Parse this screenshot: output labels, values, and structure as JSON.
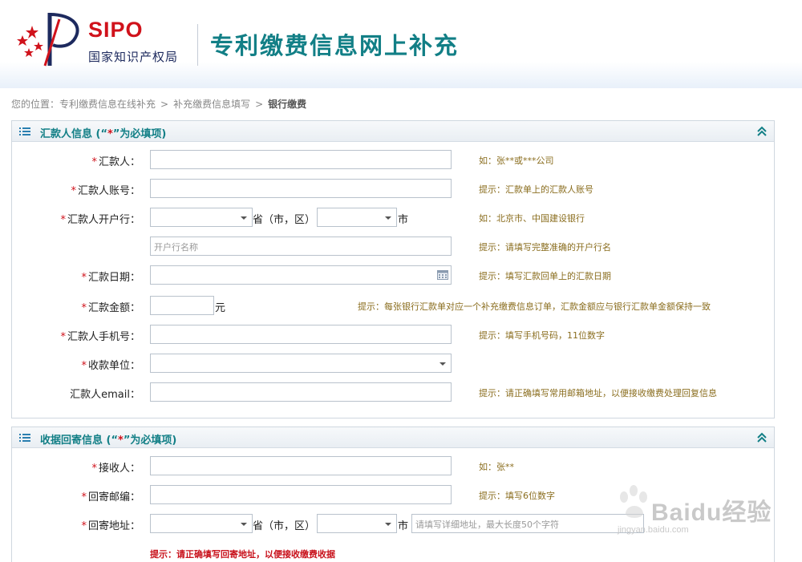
{
  "header": {
    "logo_text": "SIPO",
    "logo_subtitle": "国家知识产权局",
    "title": "专利缴费信息网上补充"
  },
  "breadcrumb": {
    "prefix": "您的位置：",
    "items": [
      "专利缴费信息在线补充",
      "补充缴费信息填写",
      "银行缴费"
    ],
    "separator": ">"
  },
  "remitter_panel": {
    "title_prefix": "汇款人信息 (“",
    "title_star": "*",
    "title_suffix": "”为必填项)",
    "fields": {
      "name": {
        "label": "汇款人：",
        "required": "*",
        "value": "",
        "hint": "如：张**或***公司"
      },
      "account": {
        "label": "汇款人账号：",
        "required": "*",
        "value": "",
        "hint": "提示：汇款单上的汇款人账号"
      },
      "bank": {
        "label": "汇款人开户行：",
        "required": "*",
        "province_value": "",
        "province_suffix": "省（市，区）",
        "city_value": "",
        "city_suffix": "市",
        "hint": "如：北京市、中国建设银行",
        "bank_name_placeholder": "开户行名称",
        "bank_name_hint": "提示：请填写完整准确的开户行名",
        "calendar_icon": "calendar-icon"
      },
      "date": {
        "label": "汇款日期：",
        "required": "*",
        "value": "",
        "hint": "提示：填写汇款回单上的汇款日期"
      },
      "amount": {
        "label": "汇款金额：",
        "required": "*",
        "value": "",
        "unit": "元",
        "hint": "提示：每张银行汇款单对应一个补充缴费信息订单，汇款金额应与银行汇款单金额保持一致"
      },
      "phone": {
        "label": "汇款人手机号：",
        "required": "*",
        "value": "",
        "hint": "提示：填写手机号码，11位数字"
      },
      "payee": {
        "label": "收款单位：",
        "required": "*",
        "value": ""
      },
      "email": {
        "label": "汇款人email：",
        "value": "",
        "hint": "提示：请正确填写常用邮箱地址，以便接收缴费处理回复信息"
      }
    }
  },
  "receipt_panel": {
    "title_prefix": "收据回寄信息 (“",
    "title_star": "*",
    "title_suffix": "”为必填项)",
    "fields": {
      "receiver": {
        "label": "接收人：",
        "required": "*",
        "value": "",
        "hint": "如：张**"
      },
      "postcode": {
        "label": "回寄邮编：",
        "required": "*",
        "value": "",
        "hint": "提示：填写6位数字"
      },
      "address": {
        "label": "回寄地址：",
        "required": "*",
        "province_value": "",
        "province_suffix": "省（市，区）",
        "city_value": "",
        "city_suffix": "市",
        "detail_placeholder": "请填写详细地址，最大长度50个字符",
        "hint": "提示：请正确填写回寄地址，以便接收缴费收据"
      }
    }
  },
  "watermark": {
    "brand": "Baidu经验",
    "url": "jingyan.baidu.com"
  },
  "colors": {
    "accent": "#127f86",
    "required": "#d0121b",
    "hint": "#8a6d1e",
    "border": "#b9c2cc"
  }
}
